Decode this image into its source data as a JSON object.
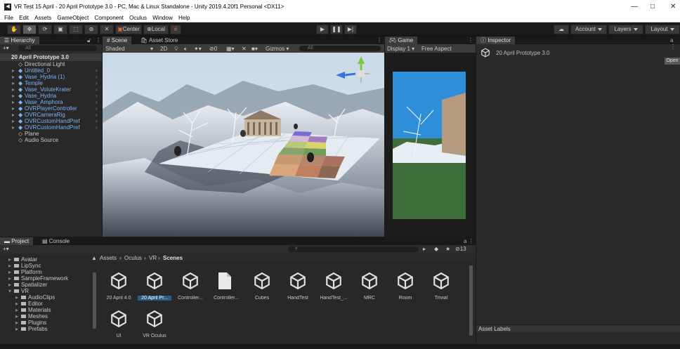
{
  "titlebar": {
    "title": "VR Test 15 April - 20 April Prototype 3.0 - PC, Mac & Linux Standalone - Unity 2019.4.20f1 Personal <DX11>",
    "minimize": "—",
    "maximize": "□",
    "close": "✕"
  },
  "menubar": [
    "File",
    "Edit",
    "Assets",
    "GameObject",
    "Component",
    "Oculus",
    "Window",
    "Help"
  ],
  "toolbar": {
    "center": "Center",
    "local": "Local",
    "account": "Account",
    "layers": "Layers",
    "layout": "Layout"
  },
  "hierarchy": {
    "tab": "Hierarchy",
    "search_placeholder": "All",
    "scene": "20 April Prototype 3.0",
    "items": [
      {
        "label": "Directional Light",
        "prefab": false
      },
      {
        "label": "Untitled_0",
        "prefab": true
      },
      {
        "label": "Vase_Hydria (1)",
        "prefab": true
      },
      {
        "label": "Temple",
        "prefab": true
      },
      {
        "label": "Vase_VoluteKrater",
        "prefab": true
      },
      {
        "label": "Vase_Hydria",
        "prefab": true
      },
      {
        "label": "Vase_Amphora",
        "prefab": true
      },
      {
        "label": "OVRPlayerController",
        "prefab": true
      },
      {
        "label": "OVRCameraRig",
        "prefab": true
      },
      {
        "label": "OVRCustomHandPref",
        "prefab": true
      },
      {
        "label": "OVRCustomHandPref",
        "prefab": true
      },
      {
        "label": "Plane",
        "prefab": false
      },
      {
        "label": "Audio Source",
        "prefab": false
      }
    ]
  },
  "scene": {
    "tab": "Scene",
    "tab2": "Asset Store",
    "shading": "Shaded",
    "mode": "2D",
    "gizmos": "Gizmos",
    "search": "All",
    "hidden_count": "0"
  },
  "game": {
    "tab": "Game",
    "display": "Display 1",
    "aspect": "Free Aspect"
  },
  "inspector": {
    "tab": "Inspector",
    "object": "20 April Prototype 3.0",
    "open": "Open",
    "asset_labels": "Asset Labels"
  },
  "project": {
    "tab": "Project",
    "tab2": "Console",
    "breadcrumb": [
      "Assets",
      "Oculus",
      "VR",
      "Scenes"
    ],
    "count": "13",
    "folders": [
      "Avatar",
      "LipSync",
      "Platform",
      "SampleFramework",
      "Spatializer",
      "VR",
      "AudioClips",
      "Editor",
      "Materials",
      "Meshes",
      "Plugins",
      "Prefabs"
    ],
    "files": [
      {
        "label": "20 April 4.0",
        "type": "scene"
      },
      {
        "label": "20 April Pr...",
        "type": "scene"
      },
      {
        "label": "Controller...",
        "type": "scene"
      },
      {
        "label": "Controller...",
        "type": "doc"
      },
      {
        "label": "Cubes",
        "type": "scene"
      },
      {
        "label": "HandTest",
        "type": "scene"
      },
      {
        "label": "HandTest_...",
        "type": "scene"
      },
      {
        "label": "MRC",
        "type": "scene"
      },
      {
        "label": "Room",
        "type": "scene"
      },
      {
        "label": "Trivial",
        "type": "scene"
      },
      {
        "label": "UI",
        "type": "scene"
      },
      {
        "label": "VR Oculus",
        "type": "scene"
      }
    ]
  }
}
